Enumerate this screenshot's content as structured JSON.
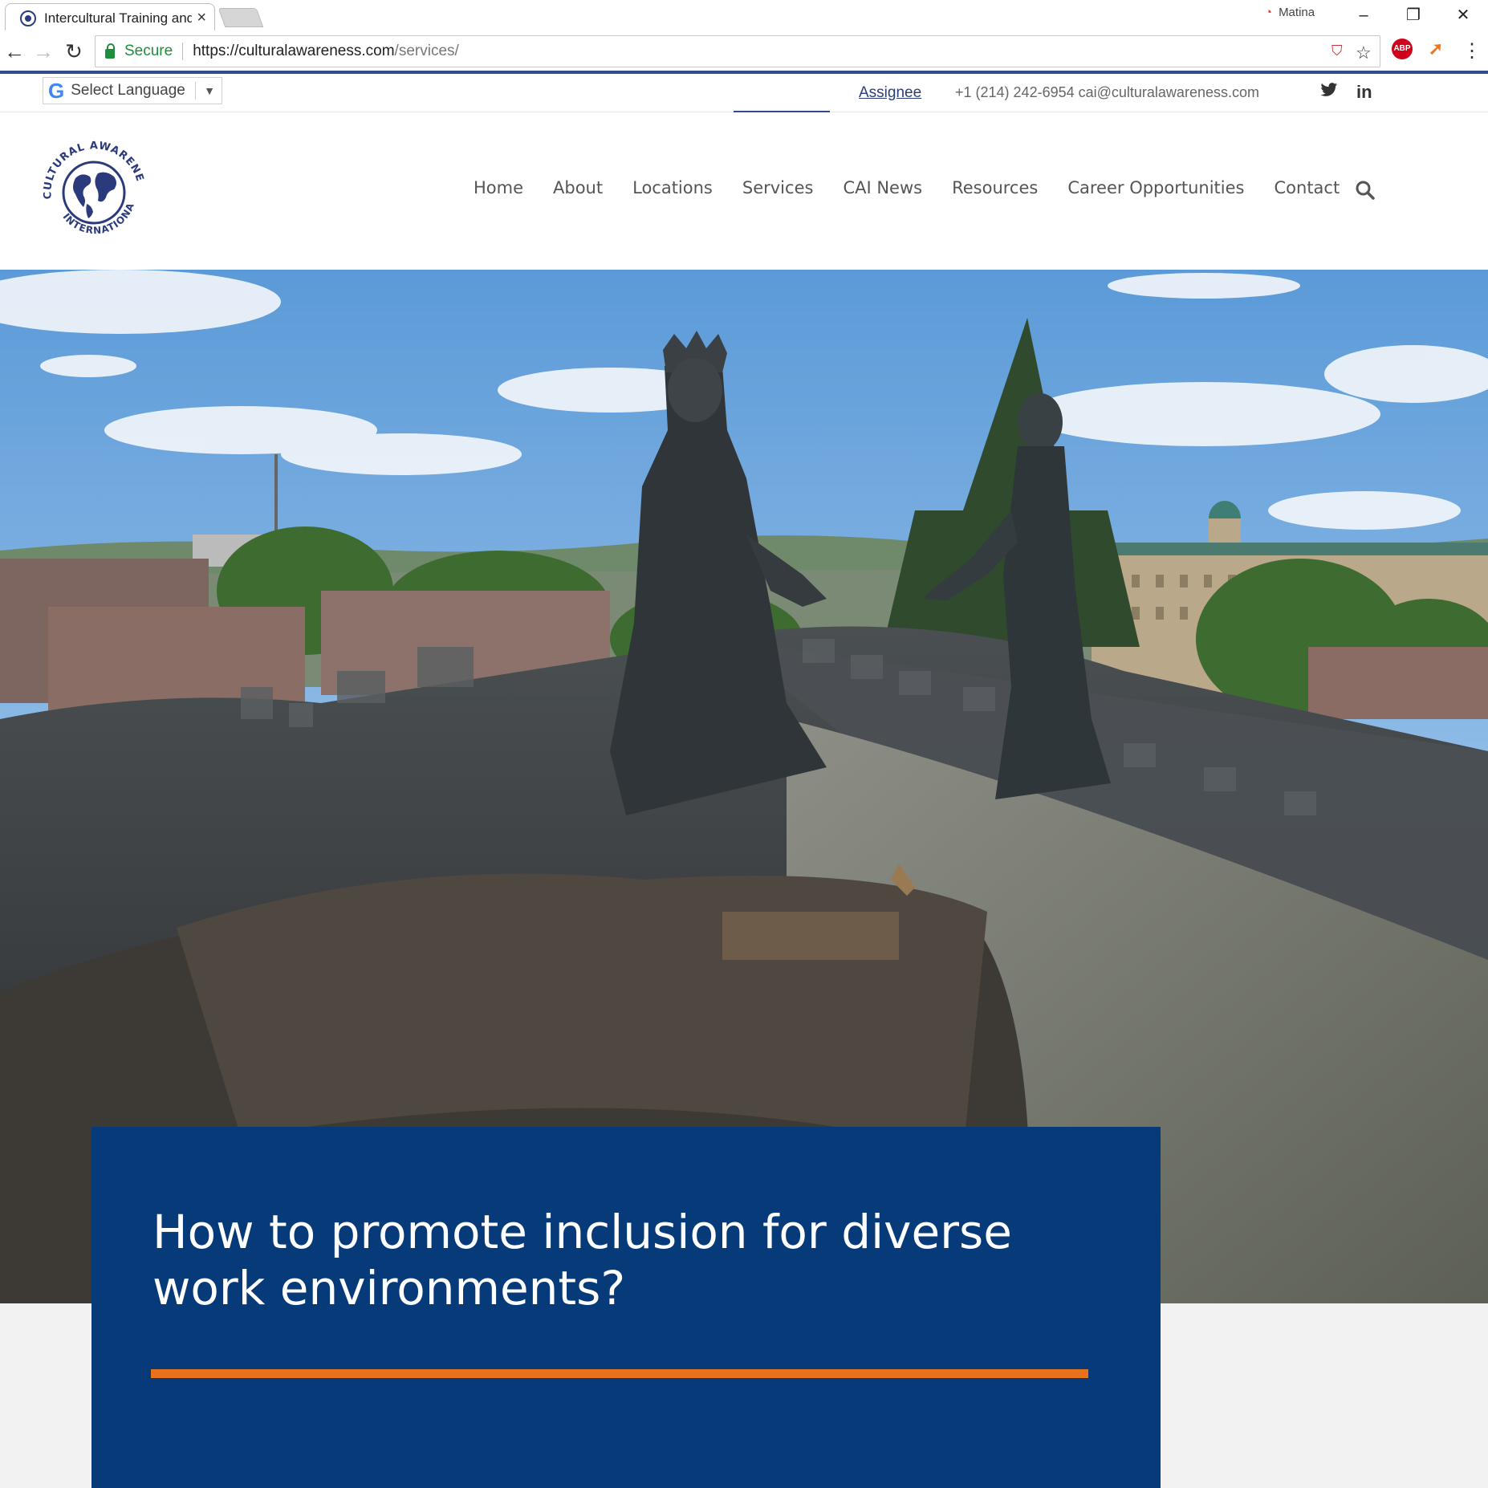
{
  "browser": {
    "tab_title": "Intercultural Training and",
    "close_glyph": "×",
    "profile_name": "Matina",
    "secure_label": "Secure",
    "url_host": "https://culturalawareness.com",
    "url_path": "/services/",
    "minimize_glyph": "–",
    "restore_glyph": "❐",
    "close_window_glyph": "✕",
    "back_glyph": "←",
    "forward_glyph": "→",
    "reload_glyph": "↻",
    "star_glyph": "☆",
    "menu_glyph": "⋮",
    "abp_label": "ABP"
  },
  "topbar": {
    "translate_label": "Select Language",
    "translate_arrow": "▼",
    "assignee_link": "Assignee",
    "contact_info": "+1 (214) 242-6954 cai@culturalawareness.com",
    "twitter_glyph": "🐦",
    "linkedin_glyph": "in"
  },
  "logo": {
    "top_text": "CULTURAL AWARENESS",
    "bottom_text": "INTERNATIONAL"
  },
  "nav": {
    "items": [
      "Home",
      "About",
      "Locations",
      "Services",
      "CAI News",
      "Resources",
      "Career Opportunities",
      "Contact"
    ],
    "active": "Services"
  },
  "hero": {
    "headline": "How to promote inclusion for diverse work environments?"
  },
  "colors": {
    "brand_blue": "#073a78",
    "accent_orange": "#e8721c",
    "secure_green": "#1e8e3e"
  }
}
